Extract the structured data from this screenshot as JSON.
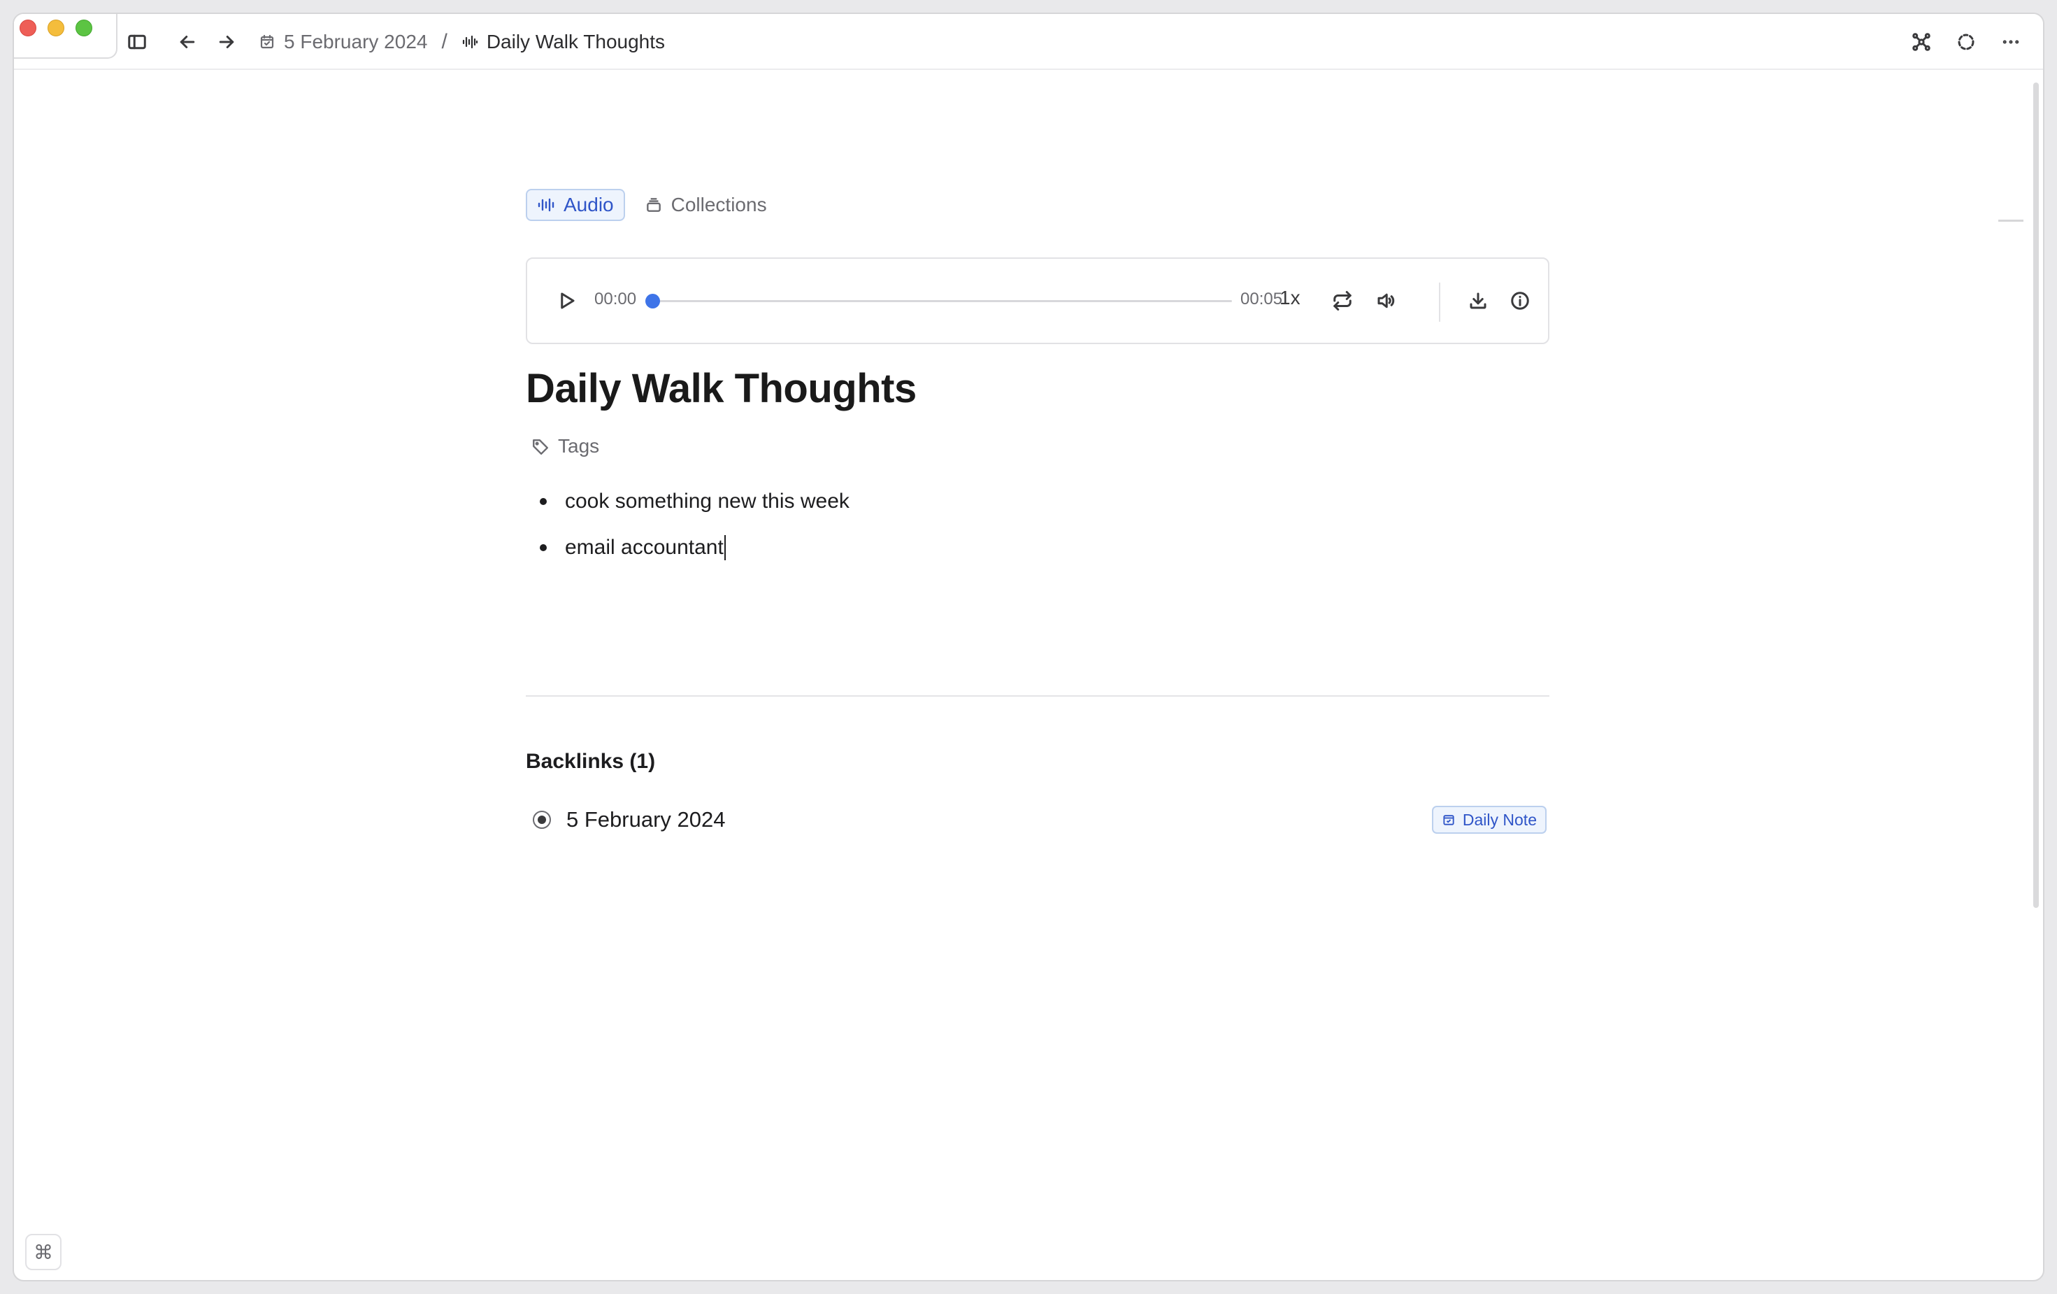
{
  "toolbar": {
    "breadcrumbs": [
      {
        "label": "5 February 2024",
        "icon": "calendar-icon"
      },
      {
        "label": "Daily Walk Thoughts",
        "icon": "audio-waveform-icon"
      }
    ],
    "separator": "/"
  },
  "note": {
    "type_chip": "Audio",
    "collections_chip": "Collections",
    "title": "Daily Walk Thoughts",
    "tags_label": "Tags",
    "bullets": [
      "cook something new this week",
      "email accountant"
    ]
  },
  "player": {
    "current_time": "00:00",
    "duration": "00:05",
    "playback_rate": "1x",
    "progress": 0
  },
  "backlinks": {
    "heading": "Backlinks (1)",
    "items": [
      {
        "label": "5 February 2024",
        "badge": "Daily Note"
      }
    ]
  },
  "shortcut_hint": "⌘",
  "colors": {
    "accent": "#3e74e8",
    "chip_text": "#2f55c8",
    "chip_bg": "#eef4fd"
  }
}
